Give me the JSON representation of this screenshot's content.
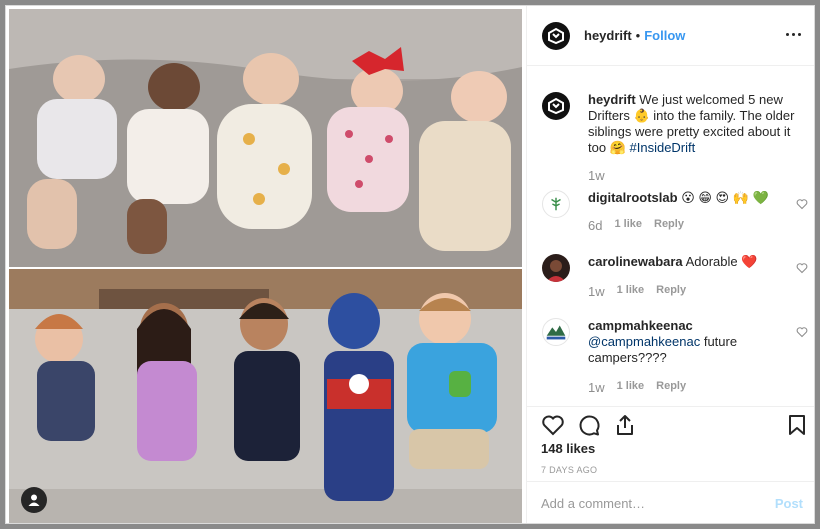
{
  "post": {
    "username": "heydrift",
    "dot": "•",
    "follow_label": "Follow",
    "caption_text": "We just welcomed 5 new Drifters 👶 into the family. The older siblings were pretty excited about it too 🤗",
    "caption_tag": "#InsideDrift",
    "caption_time": "1w"
  },
  "comments": [
    {
      "username": "digitalrootslab",
      "text": "😮 😁 😍 🙌 💚",
      "time": "6d",
      "likes": "1 like",
      "reply": "Reply"
    },
    {
      "username": "carolinewabara",
      "text": "Adorable ❤️",
      "time": "1w",
      "likes": "1 like",
      "reply": "Reply"
    },
    {
      "username": "campmahkeenac",
      "mention": "@campmahkeenac",
      "text": "future campers????",
      "time": "1w",
      "likes": "1 like",
      "reply": "Reply"
    }
  ],
  "actions": {
    "likes": "148 likes",
    "date": "7 DAYS AGO"
  },
  "composer": {
    "placeholder": "Add a comment…",
    "post_label": "Post"
  },
  "icons": [
    "heart-icon",
    "comment-icon",
    "share-icon",
    "bookmark-icon",
    "more-icon",
    "user-tag-icon"
  ],
  "colors": {
    "link": "#3897f0",
    "hashtag": "#003569",
    "muted": "#8e8e8e",
    "post_disabled": "#b2dffc"
  }
}
